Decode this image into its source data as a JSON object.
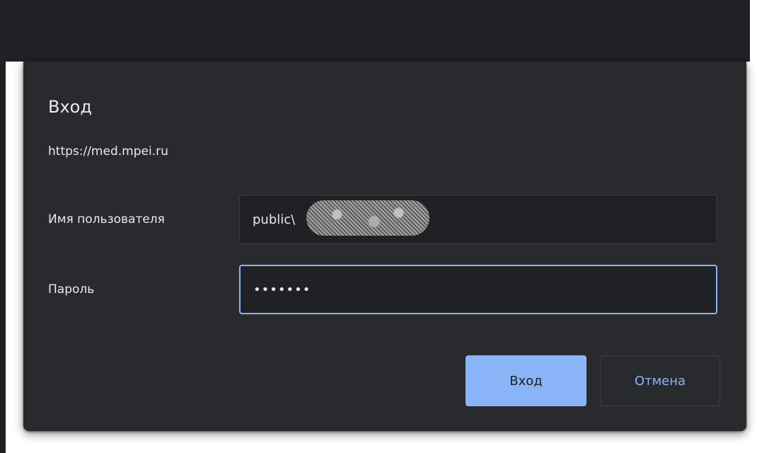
{
  "dialog": {
    "title": "Вход",
    "origin": "https://med.mpei.ru",
    "username_label": "Имя пользователя",
    "username_value": "public\\",
    "password_label": "Пароль",
    "password_value": "•••••••",
    "ok_label": "Вход",
    "cancel_label": "Отмена"
  },
  "colors": {
    "dialog_bg": "#292a2d",
    "input_bg": "#202124",
    "accent": "#8ab4f8",
    "text": "#e8eaed"
  }
}
